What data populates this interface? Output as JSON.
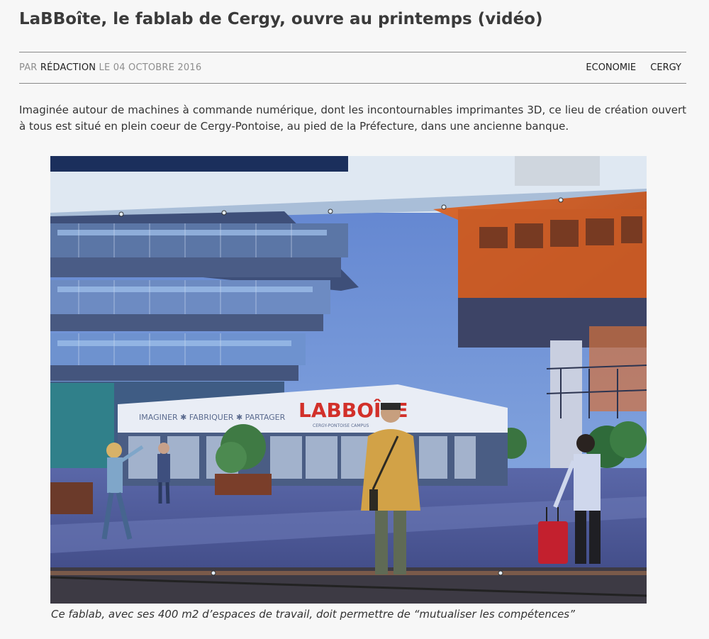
{
  "article": {
    "title": "LaBBoîte, le fablab de Cergy, ouvre au printemps (vidéo)",
    "meta": {
      "by_prefix": "PAR",
      "author": "RÉDACTION",
      "date_prefix": "LE",
      "date": "04 OCTOBRE 2016"
    },
    "categories": [
      "ECONOMIE",
      "CERGY"
    ],
    "intro": "Imaginée autour de machines à commande numérique, dont les incontournables imprimantes 3D, ce lieu de création ouvert à tous est situé en plein coeur de Cergy-Pontoise, au pied de la Préfecture, dans une ancienne banque.",
    "image": {
      "sign_logo": "LABBOÎTE",
      "sign_slogan": "IMAGINER ✱ FABRIQUER ✱ PARTAGER",
      "sign_subtitle": "CERGY-PONTOISE CAMPUS"
    },
    "caption": "Ce fablab, avec ses 400 m2 d’espaces de travail, doit permettre de “mutualiser les compétences”"
  },
  "colors": {
    "background": "#f7f7f7",
    "title": "#3a3a3a",
    "meta_grey": "#8e8e8e",
    "rule": "#8a8a8a",
    "logo_red": "#d2302a"
  }
}
